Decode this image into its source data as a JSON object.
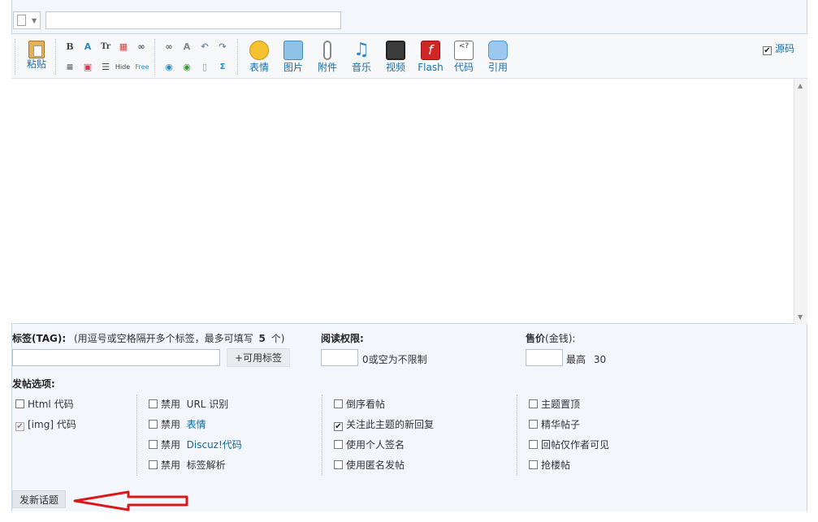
{
  "subject": {
    "value": "",
    "placeholder": ""
  },
  "toolbar": {
    "paste_label": "粘贴",
    "media": [
      {
        "key": "emoji",
        "label": "表情",
        "icon": "emoji-icon"
      },
      {
        "key": "image",
        "label": "图片",
        "icon": "image-icon"
      },
      {
        "key": "attach",
        "label": "附件",
        "icon": "paperclip-icon"
      },
      {
        "key": "music",
        "label": "音乐",
        "icon": "music-icon"
      },
      {
        "key": "video",
        "label": "视频",
        "icon": "video-icon"
      },
      {
        "key": "flash",
        "label": "Flash",
        "icon": "flash-icon"
      },
      {
        "key": "code",
        "label": "代码",
        "icon": "code-icon"
      },
      {
        "key": "quote",
        "label": "引用",
        "icon": "quote-icon"
      }
    ],
    "source_label": "源码",
    "source_checked": true
  },
  "tags": {
    "label": "标签(TAG):",
    "hint": "(用逗号或空格隔开多个标签，最多可填写",
    "max": "5",
    "hint_end": "个)",
    "value": "",
    "button": "+可用标签"
  },
  "read_perm": {
    "label": "阅读权限:",
    "value": "",
    "hint": "0或空为不限制"
  },
  "price": {
    "label": "售价",
    "unit": "(金钱):",
    "value": "",
    "max_label": "最高",
    "max_value": "30"
  },
  "options": {
    "title": "发帖选项:",
    "col1": [
      {
        "label": "Html 代码",
        "checked": false,
        "disabled": false
      },
      {
        "label": "[img] 代码",
        "checked": true,
        "disabled": true
      }
    ],
    "col2": [
      {
        "prefix": "禁用",
        "label": "URL 识别"
      },
      {
        "prefix": "禁用",
        "label": "表情"
      },
      {
        "prefix": "禁用",
        "label": "Discuz!代码"
      },
      {
        "prefix": "禁用",
        "label": "标签解析"
      }
    ],
    "col3": [
      {
        "label": "倒序看帖",
        "checked": false
      },
      {
        "label": "关注此主题的新回复",
        "checked": true
      },
      {
        "label": "使用个人签名",
        "checked": false
      },
      {
        "label": "使用匿名发帖",
        "checked": false
      }
    ],
    "col4": [
      {
        "label": "主题置顶",
        "checked": false
      },
      {
        "label": "精华帖子",
        "checked": false
      },
      {
        "label": "回帖仅作者可见",
        "checked": false
      },
      {
        "label": "抢楼帖",
        "checked": false
      }
    ]
  },
  "submit_label": "发新话题",
  "colors": {
    "accent": "#1a6fa6",
    "arrow": "#d61a1a",
    "frame_bg": "#f3f7fb"
  }
}
